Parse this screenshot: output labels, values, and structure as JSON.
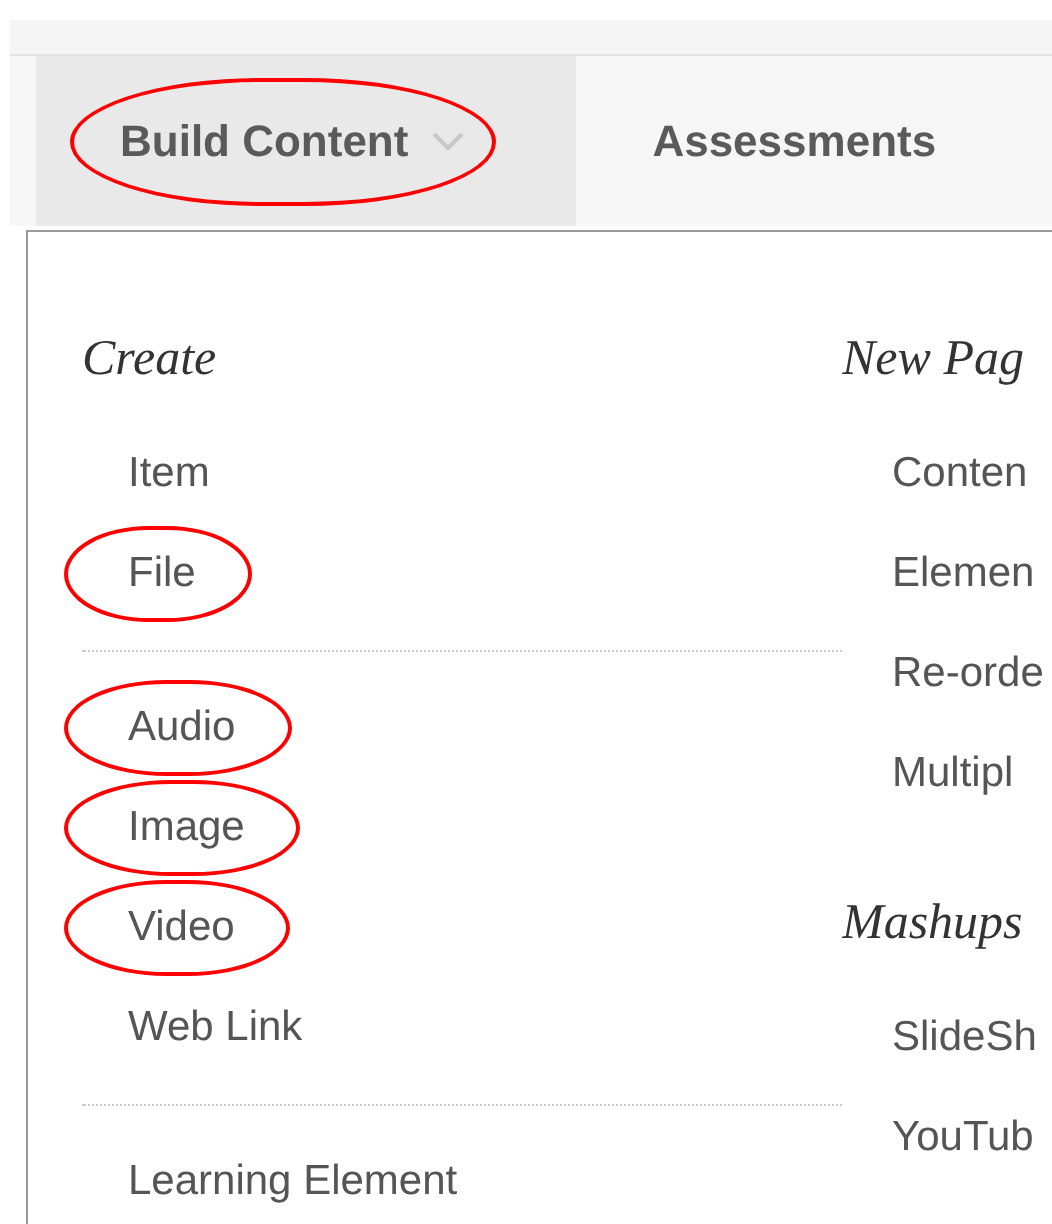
{
  "tabs": [
    {
      "label": "Build Content",
      "selected": true,
      "dropdown": true,
      "circled": true
    },
    {
      "label": "Assessments",
      "selected": false,
      "dropdown": false,
      "circled": false
    }
  ],
  "menu": {
    "columns": [
      {
        "sections": [
          {
            "heading": "Create",
            "groups": [
              [
                {
                  "label": "Item",
                  "circled": false
                },
                {
                  "label": "File",
                  "circled": true
                }
              ],
              [
                {
                  "label": "Audio",
                  "circled": true
                },
                {
                  "label": "Image",
                  "circled": true
                },
                {
                  "label": "Video",
                  "circled": true
                },
                {
                  "label": "Web Link",
                  "circled": false
                }
              ],
              [
                {
                  "label": "Learning Element",
                  "circled": false
                }
              ]
            ]
          }
        ]
      },
      {
        "sections": [
          {
            "heading": "New Pag",
            "groups": [
              [
                {
                  "label": "Conten",
                  "circled": false
                },
                {
                  "label": "Elemen",
                  "circled": false
                },
                {
                  "label": "Re-orde",
                  "circled": false
                },
                {
                  "label": "Multipl",
                  "circled": false
                }
              ]
            ]
          },
          {
            "heading": "Mashups",
            "groups": [
              [
                {
                  "label": "SlideSh",
                  "circled": false
                },
                {
                  "label": "YouTub",
                  "circled": false
                }
              ]
            ]
          }
        ]
      }
    ]
  }
}
